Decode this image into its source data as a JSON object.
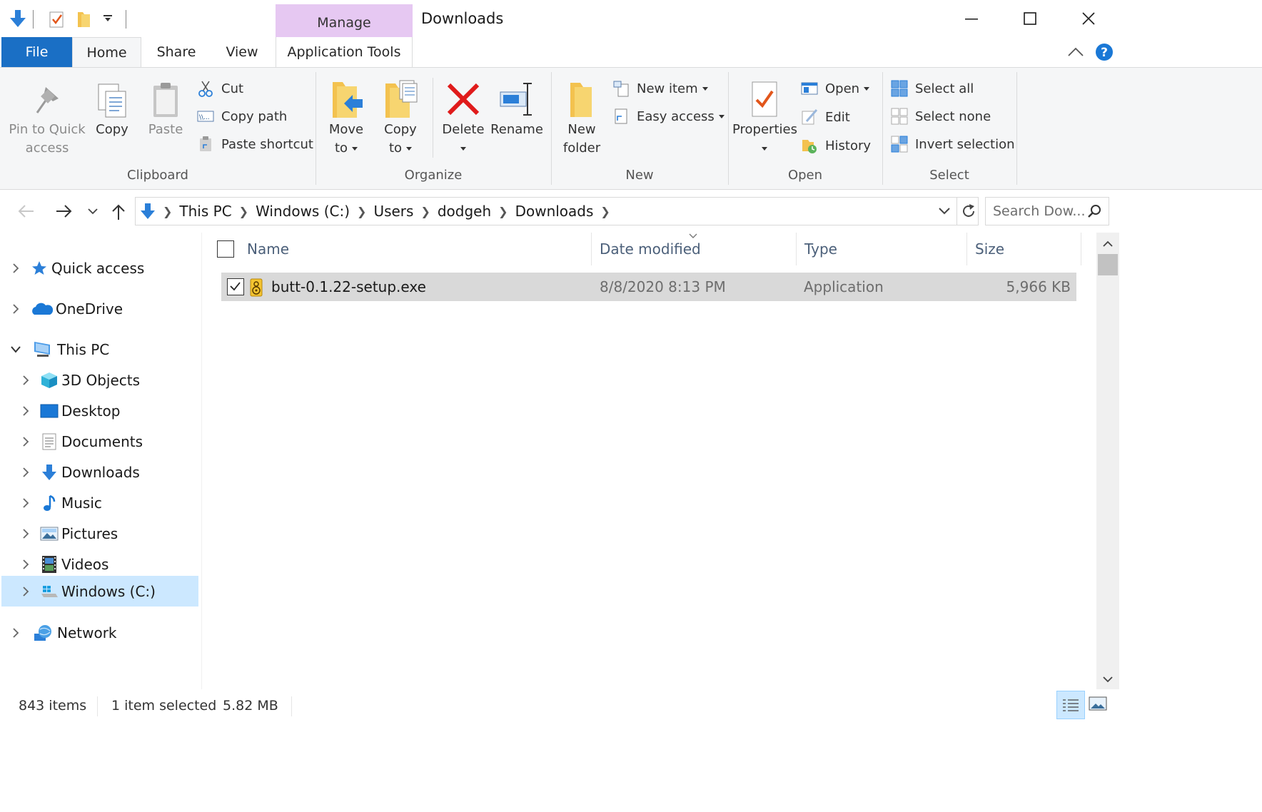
{
  "window": {
    "title": "Downloads",
    "manage_label": "Manage"
  },
  "tabs": {
    "file": "File",
    "home": "Home",
    "share": "Share",
    "view": "View",
    "app_tools": "Application Tools"
  },
  "ribbon": {
    "clipboard": {
      "label": "Clipboard",
      "pin_line1": "Pin to Quick",
      "pin_line2": "access",
      "copy": "Copy",
      "paste": "Paste",
      "cut": "Cut",
      "copy_path": "Copy path",
      "paste_shortcut": "Paste shortcut"
    },
    "organize": {
      "label": "Organize",
      "move_line1": "Move",
      "move_line2": "to",
      "copy_line1": "Copy",
      "copy_line2": "to",
      "delete": "Delete",
      "rename": "Rename"
    },
    "new": {
      "label": "New",
      "folder_line1": "New",
      "folder_line2": "folder",
      "new_item": "New item",
      "easy_access": "Easy access"
    },
    "open": {
      "label": "Open",
      "properties": "Properties",
      "open": "Open",
      "edit": "Edit",
      "history": "History"
    },
    "select": {
      "label": "Select",
      "select_all": "Select all",
      "select_none": "Select none",
      "invert": "Invert selection"
    }
  },
  "address": {
    "crumbs": [
      "This PC",
      "Windows (C:)",
      "Users",
      "dodgeh",
      "Downloads"
    ],
    "search_placeholder": "Search Dow..."
  },
  "nav": {
    "quick_access": "Quick access",
    "onedrive": "OneDrive",
    "this_pc": "This PC",
    "objects3d": "3D Objects",
    "desktop": "Desktop",
    "documents": "Documents",
    "downloads": "Downloads",
    "music": "Music",
    "pictures": "Pictures",
    "videos": "Videos",
    "windows_c": "Windows (C:)",
    "network": "Network"
  },
  "columns": {
    "name": "Name",
    "date": "Date modified",
    "type": "Type",
    "size": "Size"
  },
  "files": [
    {
      "name": "butt-0.1.22-setup.exe",
      "date": "8/8/2020 8:13 PM",
      "type": "Application",
      "size": "5,966 KB"
    }
  ],
  "status": {
    "count": "843 items",
    "selected": "1 item selected",
    "size": "5.82 MB"
  },
  "colors": {
    "accent": "#1a6fc5",
    "manage_bg": "#e6c8f2",
    "selection": "#d9d9d9",
    "nav_selection": "#cce8ff"
  }
}
